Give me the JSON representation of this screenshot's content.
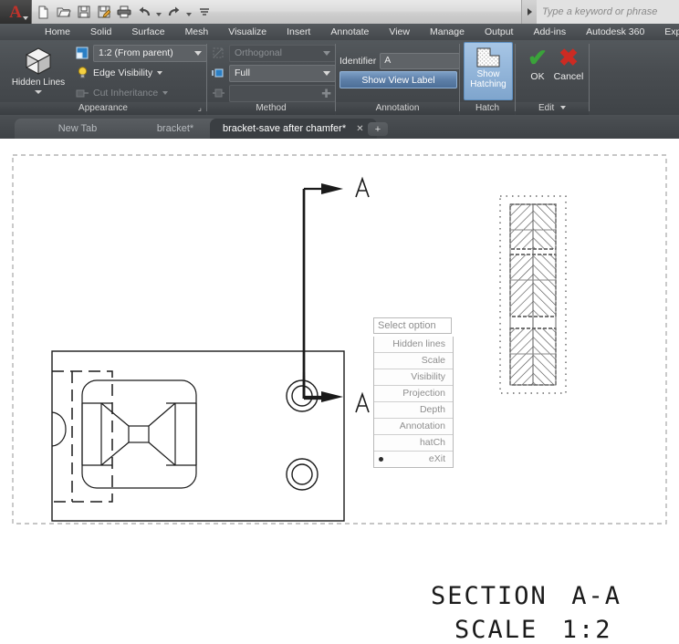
{
  "titlebar": {
    "app_logo": "A",
    "quick_access": [
      {
        "name": "new-file-icon",
        "glyph": "⬜"
      },
      {
        "name": "open-folder-icon",
        "glyph": "🗁"
      },
      {
        "name": "save-icon",
        "glyph": "💾"
      },
      {
        "name": "save-as-icon",
        "glyph": "📝"
      },
      {
        "name": "plot-print-icon",
        "glyph": "🖨"
      },
      {
        "name": "undo-icon",
        "glyph": "↶"
      },
      {
        "name": "redo-icon",
        "glyph": "↷"
      },
      {
        "name": "customize-qat-icon",
        "glyph": "≡"
      }
    ],
    "search_placeholder": "Type a keyword or phrase"
  },
  "ribbon_tabs": [
    "Home",
    "Solid",
    "Surface",
    "Mesh",
    "Visualize",
    "Insert",
    "Annotate",
    "View",
    "Manage",
    "Output",
    "Add-ins",
    "Autodesk 360",
    "Express Tools"
  ],
  "panels": {
    "appearance": {
      "label": "Appearance",
      "hidden_lines_button": "Hidden Lines",
      "scale_combo": "1:2 (From parent)",
      "edge_visibility": "Edge Visibility",
      "cut_inheritance": "Cut Inheritance"
    },
    "method": {
      "label": "Method",
      "orthogonal_combo": "Orthogonal",
      "depth_combo": "Full",
      "extra_combo": ""
    },
    "annotation": {
      "label": "Annotation",
      "identifier_label": "Identifier",
      "identifier_value": "A",
      "show_view_label_button": "Show View Label"
    },
    "hatch": {
      "label": "Hatch",
      "show_hatching_button": "Show\nHatching",
      "show_hatching_line1": "Show",
      "show_hatching_line2": "Hatching"
    },
    "edit": {
      "label": "Edit",
      "ok_button": "OK",
      "cancel_button": "Cancel",
      "ok_glyph": "✔",
      "cancel_glyph": "✖"
    }
  },
  "document_tabs": [
    {
      "label": "New Tab",
      "active": false,
      "closable": false
    },
    {
      "label": "bracket*",
      "active": false,
      "closable": false
    },
    {
      "label": "bracket-save after chamfer*",
      "active": true,
      "closable": true
    }
  ],
  "new_tab_plus": "+",
  "command_options": {
    "prompt_placeholder": "Select option",
    "items": [
      {
        "label": "Hidden lines",
        "selected": false
      },
      {
        "label": "Scale",
        "selected": false
      },
      {
        "label": "Visibility",
        "selected": false
      },
      {
        "label": "Projection",
        "selected": false
      },
      {
        "label": "Depth",
        "selected": false
      },
      {
        "label": "Annotation",
        "selected": false
      },
      {
        "label": "hatCh",
        "selected": false
      },
      {
        "label": "eXit",
        "selected": true
      }
    ]
  },
  "drawing": {
    "section_marker_top": "A",
    "section_marker_bottom": "A",
    "section_title_line1_word1": "SECTION",
    "section_title_line1_word2": "A-A",
    "section_title_line2_word1": "SCALE",
    "section_title_line2_word2": "1:2"
  },
  "colors": {
    "accent_blue": "#2b7fc4",
    "ribbon_dark": "#494d51",
    "canvas": "#ffffff",
    "geometry_line": "#1a1a1a",
    "field_highlight": "#cfcfcf",
    "ok_green": "#3aa33a",
    "cancel_red": "#cc2b23"
  }
}
